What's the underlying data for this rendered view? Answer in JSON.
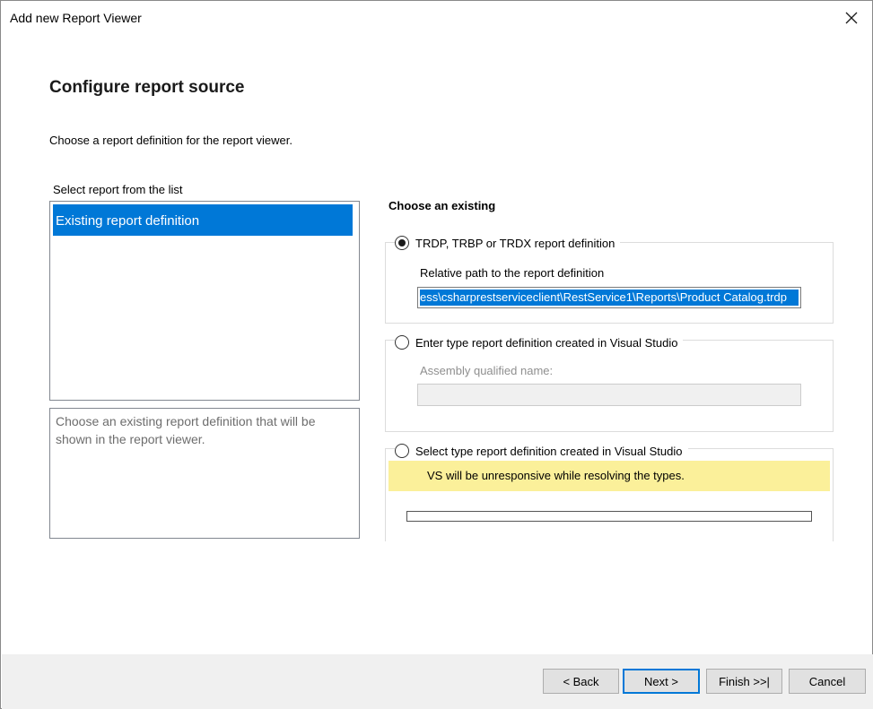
{
  "window": {
    "title": "Add new Report Viewer",
    "close_icon": "close-icon"
  },
  "page": {
    "heading": "Configure report source",
    "subtitle": "Choose a report definition for the report viewer."
  },
  "report_list": {
    "label": "Select report from the list",
    "items": [
      {
        "label": "Existing report definition",
        "selected": true
      }
    ],
    "description": "Choose an existing report definition that will be shown in the report viewer."
  },
  "source": {
    "section_title": "Choose an existing",
    "option_file": {
      "label": "TRDP, TRBP or TRDX report definition",
      "checked": true,
      "path_label": "Relative path to the report definition",
      "path_value": "ess\\csharprestserviceclient\\RestService1\\Reports\\Product Catalog.trdp"
    },
    "option_type": {
      "label": "Enter type report definition created in Visual Studio",
      "checked": false,
      "assembly_label": "Assembly qualified name:",
      "assembly_value": ""
    },
    "option_select_type": {
      "label": "Select type report definition created in Visual Studio",
      "checked": false,
      "warning": "VS will be unresponsive while resolving the types.",
      "warning_color": "#fbf09a"
    }
  },
  "footer": {
    "back": "< Back",
    "next": "Next >",
    "finish": "Finish >>|",
    "cancel": "Cancel"
  },
  "colors": {
    "accent": "#0078d7",
    "footer_bg": "#f0f0f0"
  }
}
